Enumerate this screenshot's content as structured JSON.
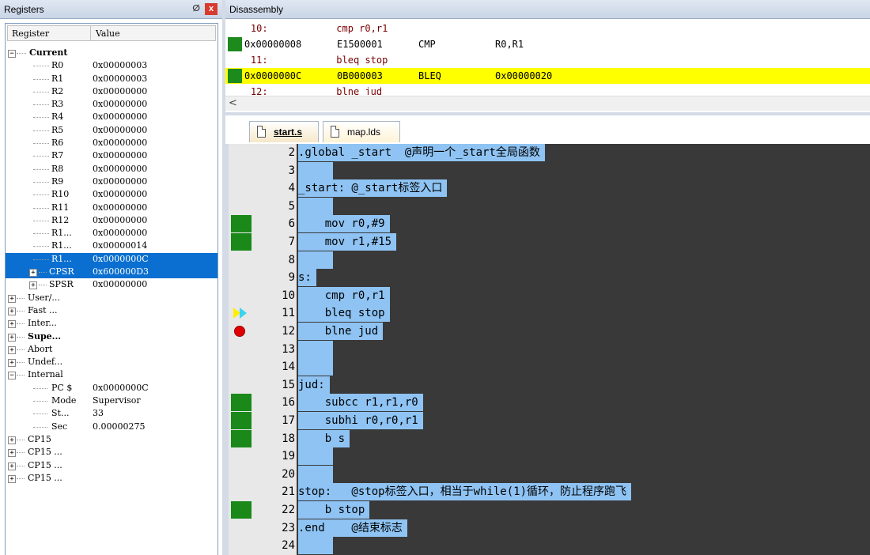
{
  "registers": {
    "title": "Registers",
    "pin_glyph": "ⵁ",
    "close_glyph": "x",
    "col_register": "Register",
    "col_value": "Value",
    "current_label": "Current",
    "rows": [
      {
        "name": "R0",
        "value": "0x00000003"
      },
      {
        "name": "R1",
        "value": "0x00000003"
      },
      {
        "name": "R2",
        "value": "0x00000000"
      },
      {
        "name": "R3",
        "value": "0x00000000"
      },
      {
        "name": "R4",
        "value": "0x00000000"
      },
      {
        "name": "R5",
        "value": "0x00000000"
      },
      {
        "name": "R6",
        "value": "0x00000000"
      },
      {
        "name": "R7",
        "value": "0x00000000"
      },
      {
        "name": "R8",
        "value": "0x00000000"
      },
      {
        "name": "R9",
        "value": "0x00000000"
      },
      {
        "name": "R10",
        "value": "0x00000000"
      },
      {
        "name": "R11",
        "value": "0x00000000"
      },
      {
        "name": "R12",
        "value": "0x00000000"
      },
      {
        "name": "R1...",
        "value": "0x00000000"
      },
      {
        "name": "R1...",
        "value": "0x00000014"
      },
      {
        "name": "R1...",
        "value": "0x0000000C"
      },
      {
        "name": "CPSR",
        "value": "0x600000D3"
      },
      {
        "name": "SPSR",
        "value": "0x00000000"
      }
    ],
    "groups": [
      "User/...",
      "Fast ...",
      "Inter...",
      "Supe...",
      "Abort",
      "Undef..."
    ],
    "internal_label": "Internal",
    "internal_rows": [
      {
        "name": "PC  $",
        "value": "0x0000000C"
      },
      {
        "name": "Mode",
        "value": "Supervisor"
      },
      {
        "name": "St...",
        "value": "33"
      },
      {
        "name": "Sec",
        "value": "0.00000275"
      }
    ],
    "cp15": [
      "CP15",
      "CP15 ...",
      "CP15 ...",
      "CP15 ..."
    ]
  },
  "disassembly": {
    "title": "Disassembly",
    "lines": [
      {
        "type": "src",
        "text": "    10:            cmp r0,r1"
      },
      {
        "type": "asm",
        "addr": "0x00000008",
        "op": "E1500001",
        "mn": "CMP",
        "args": "R0,R1"
      },
      {
        "type": "src",
        "text": "    11:            bleq stop"
      },
      {
        "type": "asm",
        "addr": "0x0000000C",
        "op": "0B000003",
        "mn": "BLEQ",
        "args": "0x00000020"
      },
      {
        "type": "src",
        "text": "    12:            blne jud"
      }
    ],
    "scroll_glyph": "<"
  },
  "tabs": [
    {
      "label": "start.s"
    },
    {
      "label": "map.lds"
    }
  ],
  "editor": {
    "lines": [
      {
        "num": "2",
        "text": ".global _start  @声明一个_start全局函数"
      },
      {
        "num": "3",
        "text": ""
      },
      {
        "num": "4",
        "text": "_start: @_start标签入口"
      },
      {
        "num": "5",
        "text": ""
      },
      {
        "num": "6",
        "text": "    mov r0,#9"
      },
      {
        "num": "7",
        "text": "    mov r1,#15"
      },
      {
        "num": "8",
        "text": ""
      },
      {
        "num": "9",
        "text": "s:"
      },
      {
        "num": "10",
        "text": "    cmp r0,r1"
      },
      {
        "num": "11",
        "text": "    bleq stop"
      },
      {
        "num": "12",
        "text": "    blne jud"
      },
      {
        "num": "13",
        "text": ""
      },
      {
        "num": "14",
        "text": ""
      },
      {
        "num": "15",
        "text": "jud:"
      },
      {
        "num": "16",
        "text": "    subcc r1,r1,r0"
      },
      {
        "num": "17",
        "text": "    subhi r0,r0,r1"
      },
      {
        "num": "18",
        "text": "    b s"
      },
      {
        "num": "19",
        "text": ""
      },
      {
        "num": "20",
        "text": ""
      },
      {
        "num": "21",
        "text": "stop:   @stop标签入口，相当于while(1)循环，防止程序跑飞"
      },
      {
        "num": "22",
        "text": "    b stop"
      },
      {
        "num": "23",
        "text": ".end    @结束标志"
      },
      {
        "num": "24",
        "text": ""
      }
    ]
  }
}
